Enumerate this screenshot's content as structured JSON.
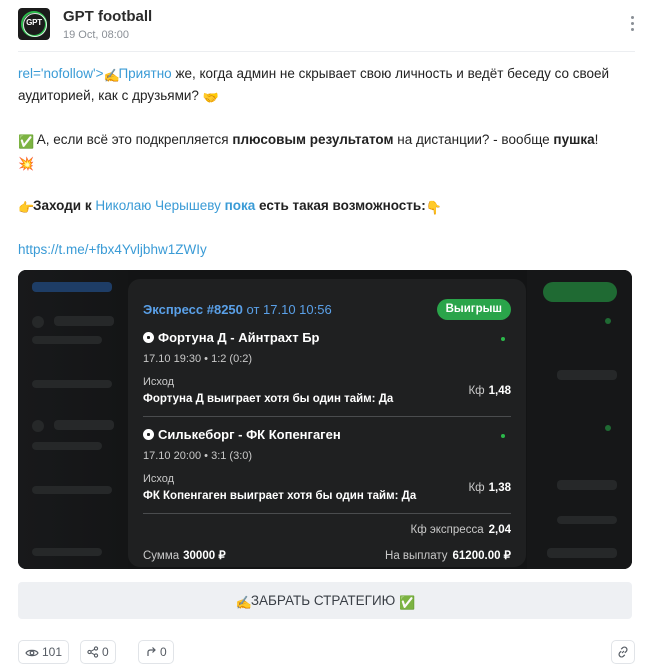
{
  "header": {
    "channel_name": "GPT football",
    "date": "19 Oct, 08:00",
    "avatar_text": "GPT"
  },
  "message": {
    "p1_prefix": "rel='nofollow'>",
    "p1_link": "Приятно",
    "p1_rest": " же, когда админ не скрывает свою личность и ведёт беседу со своей аудиторией, как с друзьями? ",
    "p2_a": " А, если всё это подкрепляется ",
    "p2_b": "плюсовым результатом",
    "p2_c": " на дистанции? - вообще ",
    "p2_d": "пушка",
    "p2_e": "!",
    "p3_a": "Заходи к ",
    "p3_link": "Николаю Черышеву",
    "p3_b": " ",
    "p3_c": "пока",
    "p3_d": " есть такая возможность:",
    "url": "https://t.me/+fbx4Yvljbhw1ZWIy"
  },
  "bet_card": {
    "title": "Экспресс #8250",
    "time": " от 17.10 10:56",
    "badge": "Выигрыш",
    "matches": [
      {
        "title": "Фортуна Д - Айнтрахт Бр",
        "meta": "17.10 19:30 • 1:2 (0:2)",
        "outcome_label": "Исход",
        "outcome": "Фортуна Д выиграет хотя бы один тайм: Да",
        "coef_label": "Кф",
        "coef": "1,48"
      },
      {
        "title": "Силькеборг - ФК Копенгаген",
        "meta": "17.10 20:00 • 3:1 (3:0)",
        "outcome_label": "Исход",
        "outcome": "ФК Копенгаген выиграет хотя бы один тайм: Да",
        "coef_label": "Кф",
        "coef": "1,38"
      }
    ],
    "express_coef_label": "Кф экспресса",
    "express_coef": "2,04",
    "sum_label": "Сумма",
    "sum": "30000 ₽",
    "payout_label": "На выплату",
    "payout": "61200.00 ₽"
  },
  "cta": {
    "label": "ЗАБРАТЬ СТРАТЕГИЮ"
  },
  "footer": {
    "views": "101",
    "shares": "0",
    "forwards": "0"
  },
  "colors": {
    "link": "#3a9bd6",
    "win_badge": "#2aa44a",
    "card_title": "#5aa0e8"
  }
}
